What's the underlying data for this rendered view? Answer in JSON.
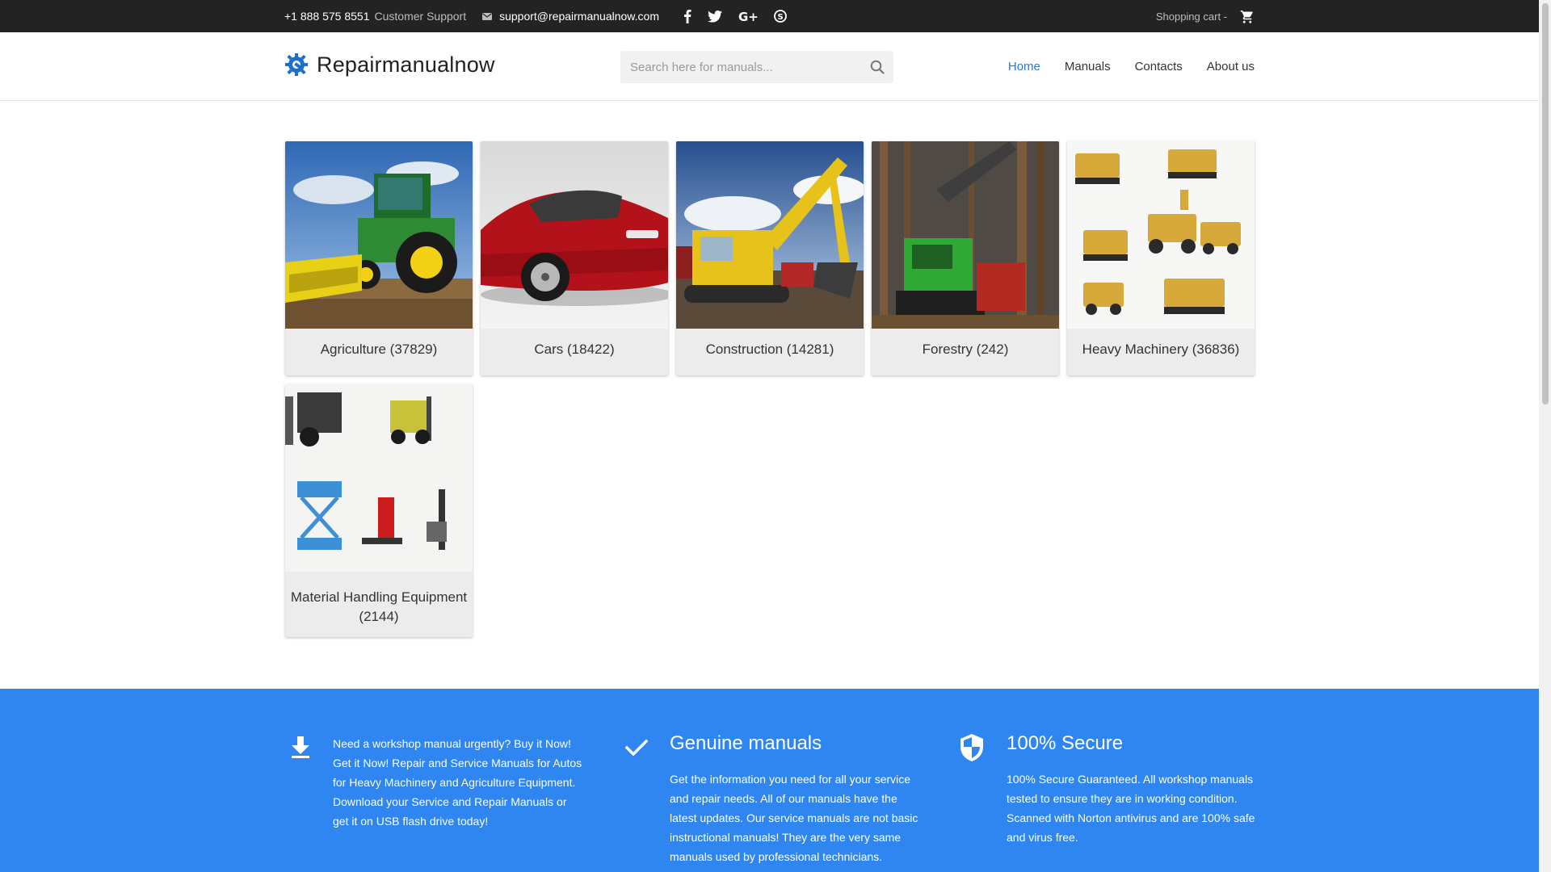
{
  "topbar": {
    "phone": "+1 888 575 8551",
    "support_label": "Customer Support",
    "email": "support@repairmanualnow.com",
    "social": [
      "facebook-icon",
      "twitter-icon",
      "google-plus-icon",
      "skype-icon"
    ],
    "cart_label": "Shopping cart -"
  },
  "header": {
    "logo_text": "Repairmanualnow",
    "search_placeholder": "Search here for manuals...",
    "nav": [
      {
        "label": "Home",
        "active": true
      },
      {
        "label": "Manuals",
        "active": false
      },
      {
        "label": "Contacts",
        "active": false
      },
      {
        "label": "About us",
        "active": false
      }
    ]
  },
  "categories": [
    {
      "label": "Agriculture (37829)",
      "image": "combine-harvester"
    },
    {
      "label": "Cars (18422)",
      "image": "red-sedan"
    },
    {
      "label": "Construction (14281)",
      "image": "yellow-excavator"
    },
    {
      "label": "Forestry (242)",
      "image": "green-harvester"
    },
    {
      "label": "Heavy Machinery (36836)",
      "image": "heavy-machines-collage"
    },
    {
      "label": "Material Handling Equipment (2144)",
      "image": "forklifts-collage"
    }
  ],
  "features": [
    {
      "icon": "download-icon",
      "title": "",
      "text": "Need a workshop manual urgently? Buy it Now! Get it Now! Repair and Service Manuals for Autos for Heavy Machinery and Agriculture Equipment. Download your Service and Repair Manuals or get it on USB flash drive today!"
    },
    {
      "icon": "checkmark-icon",
      "title": "Genuine manuals",
      "text": "Get the information you need for all your service and repair needs. All of our manuals have the latest updates. Our service manuals are not basic instructional manuals! They are the very same manuals used by professional technicians."
    },
    {
      "icon": "shield-icon",
      "title": "100% Secure",
      "text": "100% Secure Guaranteed. All workshop manuals tested to ensure they are in working condition. Scanned with Norton antivirus and are 100% safe and virus free."
    }
  ],
  "colors": {
    "topbar_bg": "#232323",
    "accent": "#2b79d9",
    "band_bg": "#2f86f0",
    "card_bg": "#ececec"
  }
}
